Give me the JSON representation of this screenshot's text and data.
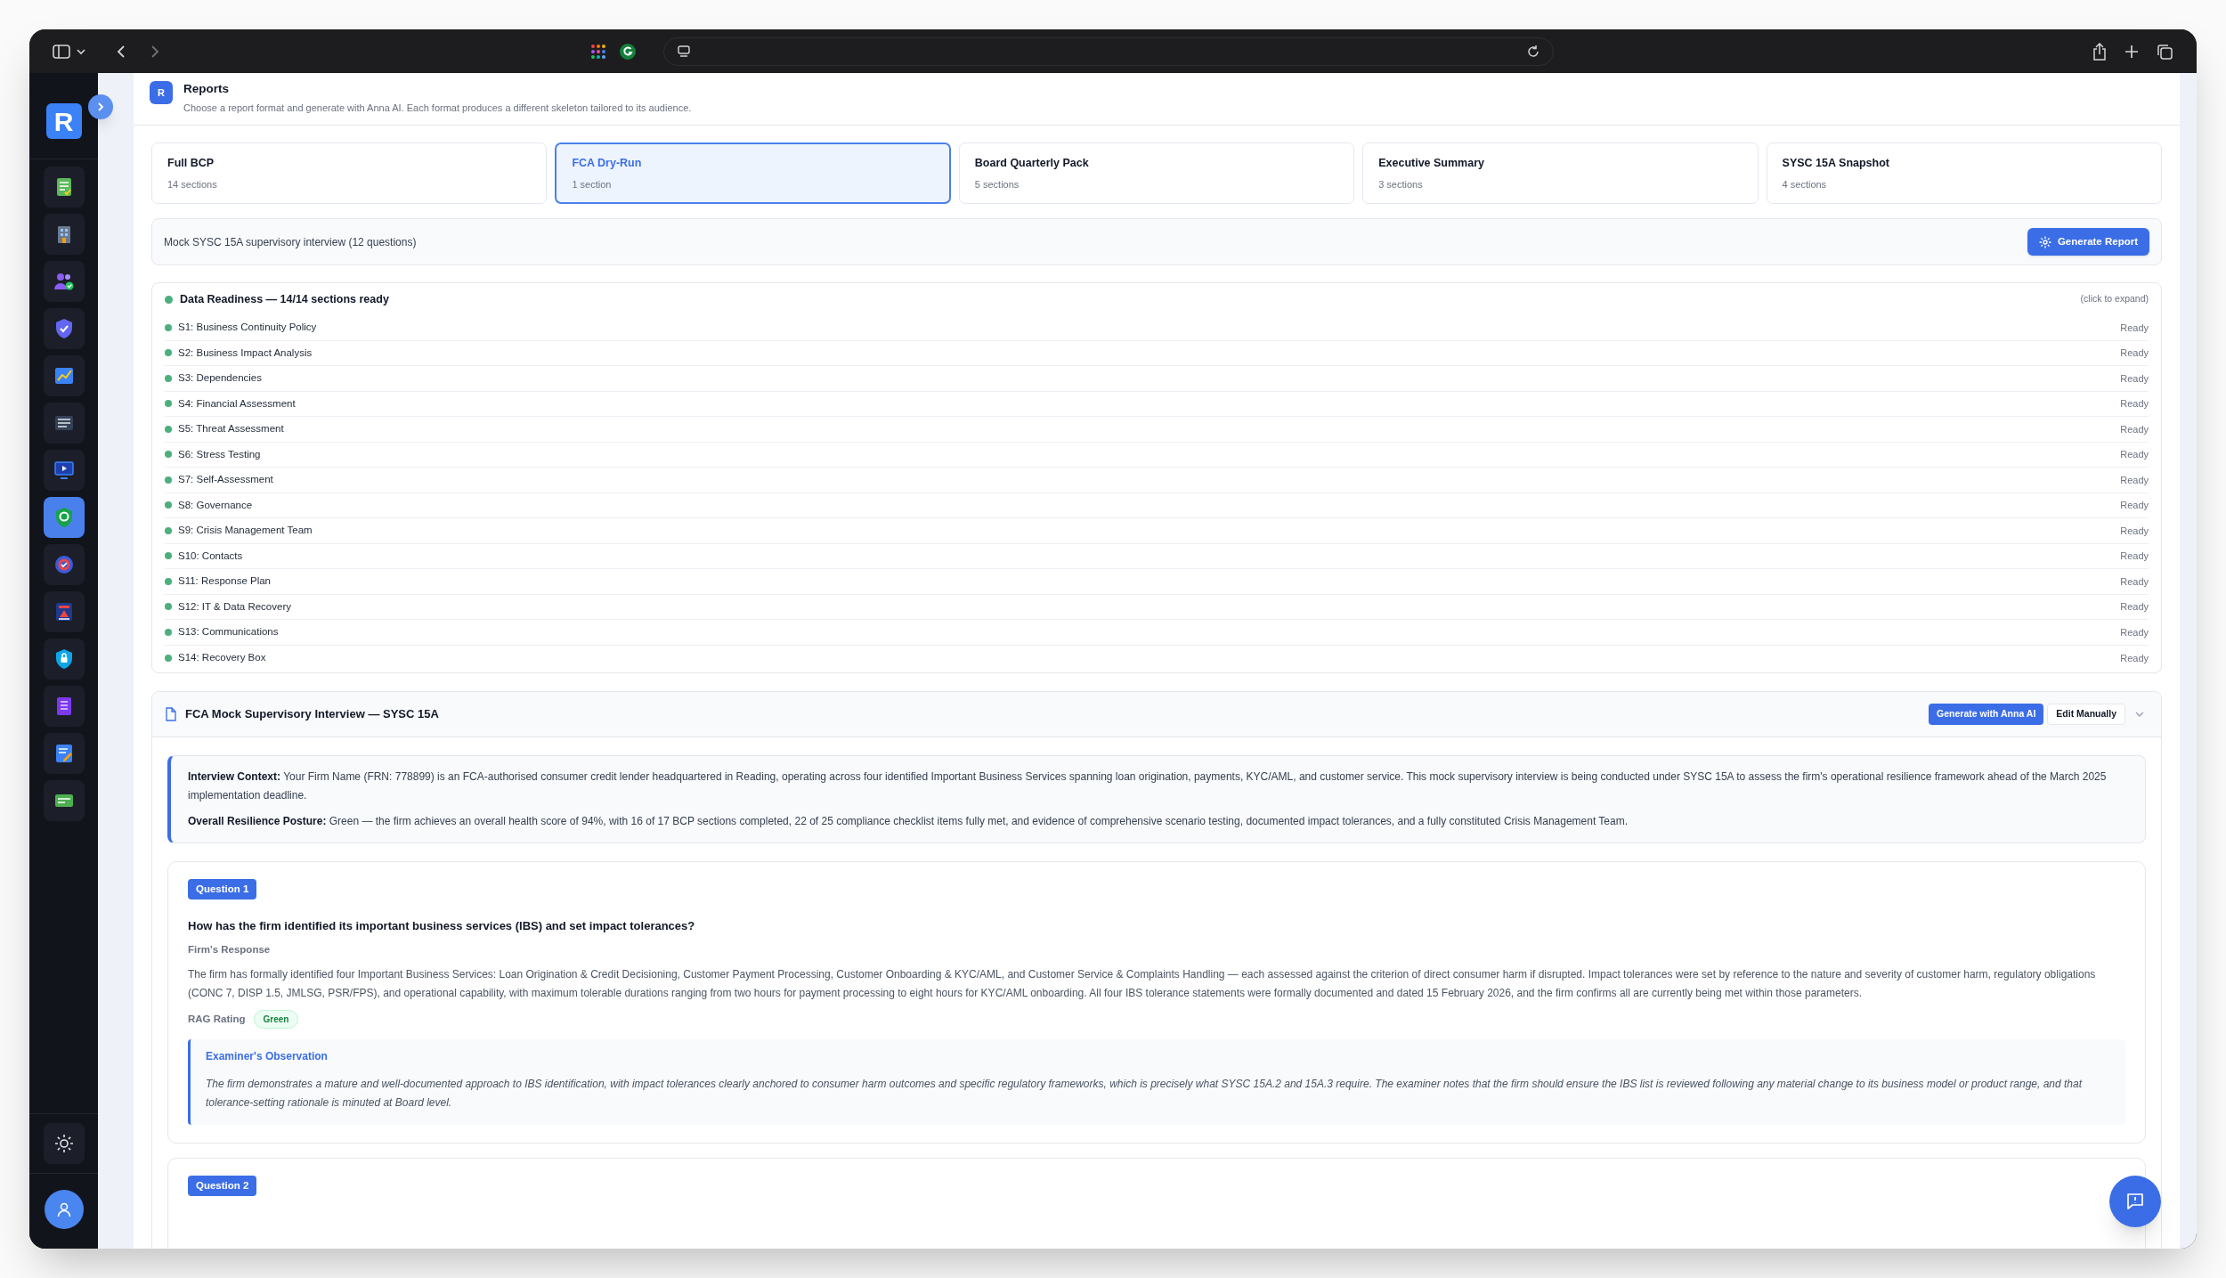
{
  "sidebar": {
    "logo": "R",
    "items": [
      {
        "selected": false
      },
      {
        "selected": false
      },
      {
        "selected": false
      },
      {
        "selected": false
      },
      {
        "selected": false
      },
      {
        "selected": false
      },
      {
        "selected": false
      },
      {
        "selected": true
      },
      {
        "selected": false
      },
      {
        "selected": false
      },
      {
        "selected": false
      },
      {
        "selected": false
      },
      {
        "selected": false
      },
      {
        "selected": false
      }
    ]
  },
  "header": {
    "badge": "R",
    "title": "Reports",
    "subtitle": "Choose a report format and generate with Anna AI. Each format produces a different skeleton tailored to its audience."
  },
  "formats": [
    {
      "title": "Full BCP",
      "sections": "14 sections",
      "selected": false
    },
    {
      "title": "FCA Dry-Run",
      "sections": "1 section",
      "selected": true
    },
    {
      "title": "Board Quarterly Pack",
      "sections": "5 sections",
      "selected": false
    },
    {
      "title": "Executive Summary",
      "sections": "3 sections",
      "selected": false
    },
    {
      "title": "SYSC 15A Snapshot",
      "sections": "4 sections",
      "selected": false
    }
  ],
  "generate_bar": {
    "description": "Mock SYSC 15A supervisory interview (12 questions)",
    "button": "Generate Report"
  },
  "readiness": {
    "title": "Data Readiness — 14/14 sections ready",
    "hint": "(click to expand)",
    "rows": [
      {
        "name": "S1: Business Continuity Policy",
        "status": "Ready"
      },
      {
        "name": "S2: Business Impact Analysis",
        "status": "Ready"
      },
      {
        "name": "S3: Dependencies",
        "status": "Ready"
      },
      {
        "name": "S4: Financial Assessment",
        "status": "Ready"
      },
      {
        "name": "S5: Threat Assessment",
        "status": "Ready"
      },
      {
        "name": "S6: Stress Testing",
        "status": "Ready"
      },
      {
        "name": "S7: Self-Assessment",
        "status": "Ready"
      },
      {
        "name": "S8: Governance",
        "status": "Ready"
      },
      {
        "name": "S9: Crisis Management Team",
        "status": "Ready"
      },
      {
        "name": "S10: Contacts",
        "status": "Ready"
      },
      {
        "name": "S11: Response Plan",
        "status": "Ready"
      },
      {
        "name": "S12: IT & Data Recovery",
        "status": "Ready"
      },
      {
        "name": "S13: Communications",
        "status": "Ready"
      },
      {
        "name": "S14: Recovery Box",
        "status": "Ready"
      }
    ]
  },
  "report_section": {
    "title": "FCA Mock Supervisory Interview — SYSC 15A",
    "buttons": [
      "Generate with Anna AI",
      "Edit Manually"
    ],
    "context": [
      "**Interview Context:** Your Firm Name (FRN: 778899) is an FCA-authorised consumer credit lender headquartered in Reading, operating across four identified Important Business Services spanning loan origination, payments, KYC/AML, and customer service. This mock supervisory interview is being conducted under SYSC 15A to assess the firm's operational resilience framework ahead of the March 2025 implementation deadline.",
      "**Overall Resilience Posture:** Green — the firm achieves an overall health score of 94%, with 16 of 17 BCP sections completed, 22 of 25 compliance checklist items fully met, and evidence of comprehensive scenario testing, documented impact tolerances, and a fully constituted Crisis Management Team."
    ],
    "questions": [
      {
        "badge": "Question 1",
        "question": "How has the firm identified its important business services (IBS) and set impact tolerances?",
        "response_label": "Firm's Response",
        "response": "The firm has formally identified four Important Business Services: Loan Origination & Credit Decisioning, Customer Payment Processing, Customer Onboarding & KYC/AML, and Customer Service & Complaints Handling — each assessed against the criterion of direct consumer harm if disrupted. Impact tolerances were set by reference to the nature and severity of customer harm, regulatory obligations (CONC 7, DISP 1.5, JMLSG, PSR/FPS), and operational capability, with maximum tolerable durations ranging from two hours for payment processing to eight hours for KYC/AML onboarding. All four IBS tolerance statements were formally documented and dated 15 February 2026, and the firm confirms all are currently being met within those parameters.",
        "rag_label": "RAG Rating",
        "rag": "Green",
        "observation_title": "Examiner's Observation",
        "observation": "The firm demonstrates a mature and well-documented approach to IBS identification, with impact tolerances clearly anchored to consumer harm outcomes and specific regulatory frameworks, which is precisely what SYSC 15A.2 and 15A.3 require. The examiner notes that the firm should ensure the IBS list is reviewed following any material change to its business model or product range, and that tolerance-setting rationale is minuted at Board level."
      },
      {
        "badge": "Question 2"
      }
    ]
  }
}
